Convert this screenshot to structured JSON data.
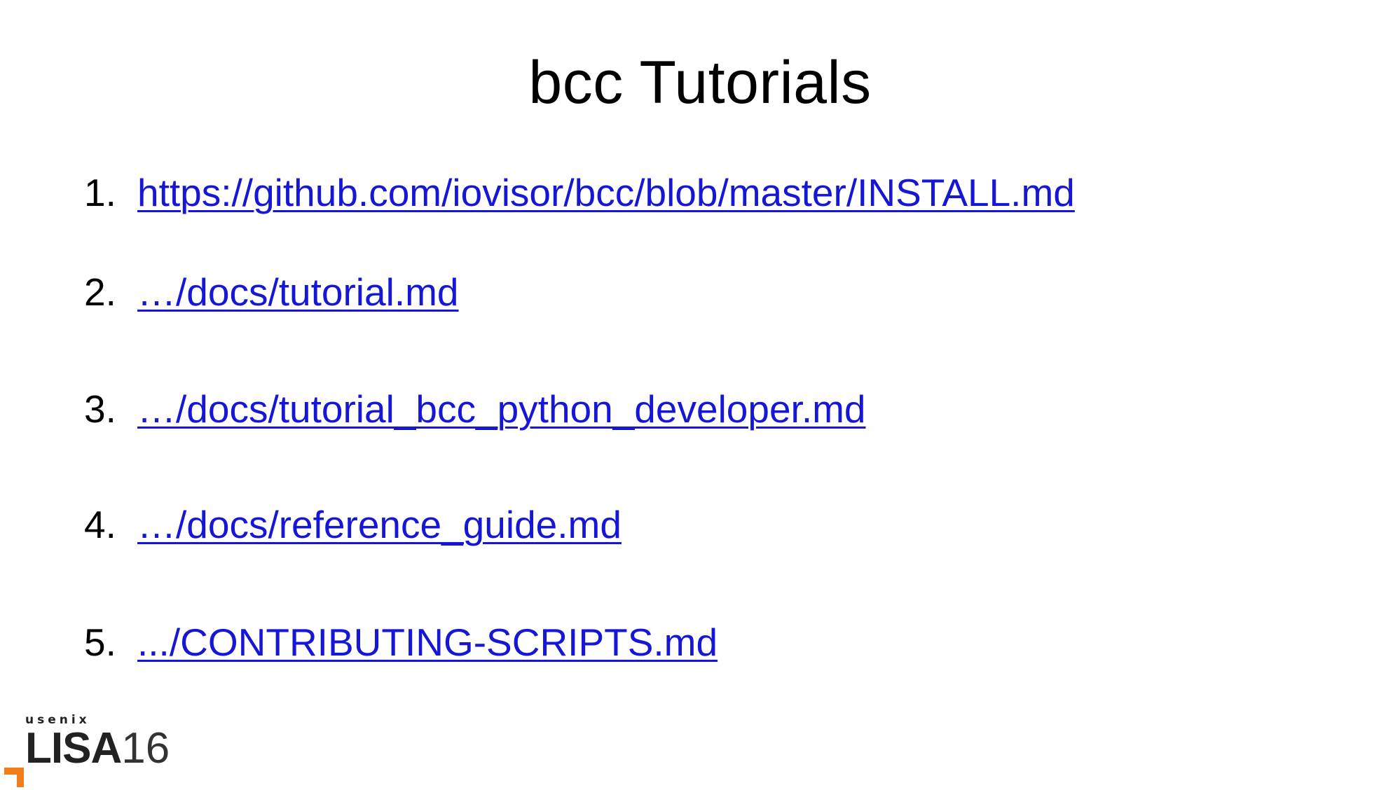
{
  "slide": {
    "title": "bcc Tutorials",
    "items": [
      {
        "number": "1.",
        "text": "https://github.com/iovisor/bcc/blob/master/INSTALL.md"
      },
      {
        "number": "2.",
        "text": "…/docs/tutorial.md"
      },
      {
        "number": "3.",
        "text": "…/docs/tutorial_bcc_python_developer.md"
      },
      {
        "number": "4.",
        "text": "…/docs/reference_guide.md"
      },
      {
        "number": "5.",
        "text": ".../CONTRIBUTING-SCRIPTS.md"
      }
    ],
    "link_color": "#1616d6"
  },
  "logo": {
    "org": "usenix",
    "event": "LISA",
    "year": "16",
    "accent_color": "#f07f1b",
    "icon": "lisa16-logo"
  }
}
